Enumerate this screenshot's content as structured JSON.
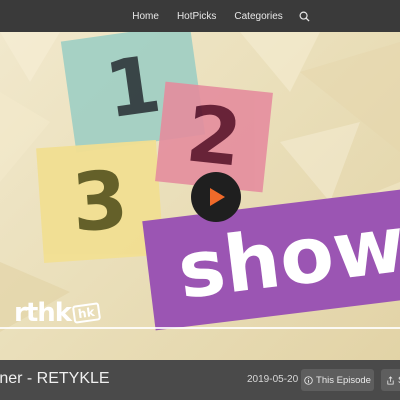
{
  "nav": {
    "items": [
      {
        "label": "Home"
      },
      {
        "label": "HotPicks"
      },
      {
        "label": "Categories"
      }
    ],
    "search_icon": "search-icon"
  },
  "poster": {
    "card_1": "1",
    "card_2": "2",
    "card_3": "3",
    "show_text": "show",
    "brand": "rthk",
    "brand_badge": "hk",
    "colors": {
      "card_1": "#9fcfc4",
      "card_2": "#e58d9e",
      "card_3": "#f2df92",
      "show": "#9b55b3",
      "background": "#eadfba"
    },
    "play_icon": "play-icon"
  },
  "info": {
    "title": "rner - RETYKLE",
    "date": "2019-05-20",
    "this_episode_label": "This Episode",
    "this_episode_icon": "info-icon",
    "share_label": "S",
    "share_icon": "share-icon"
  }
}
